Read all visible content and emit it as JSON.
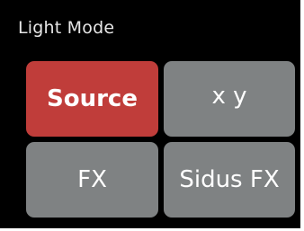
{
  "header": {
    "title": "Light Mode"
  },
  "mode_tiles": [
    {
      "label": "Source",
      "selected": true
    },
    {
      "label": "x y",
      "selected": false
    },
    {
      "label": "FX",
      "selected": false
    },
    {
      "label": "Sidus FX",
      "selected": false
    }
  ],
  "colors": {
    "background": "#000000",
    "tile": "#7f8283",
    "selected_tile": "#c03d3a",
    "title_text": "#e6e6e6",
    "tile_text": "#ffffff"
  }
}
